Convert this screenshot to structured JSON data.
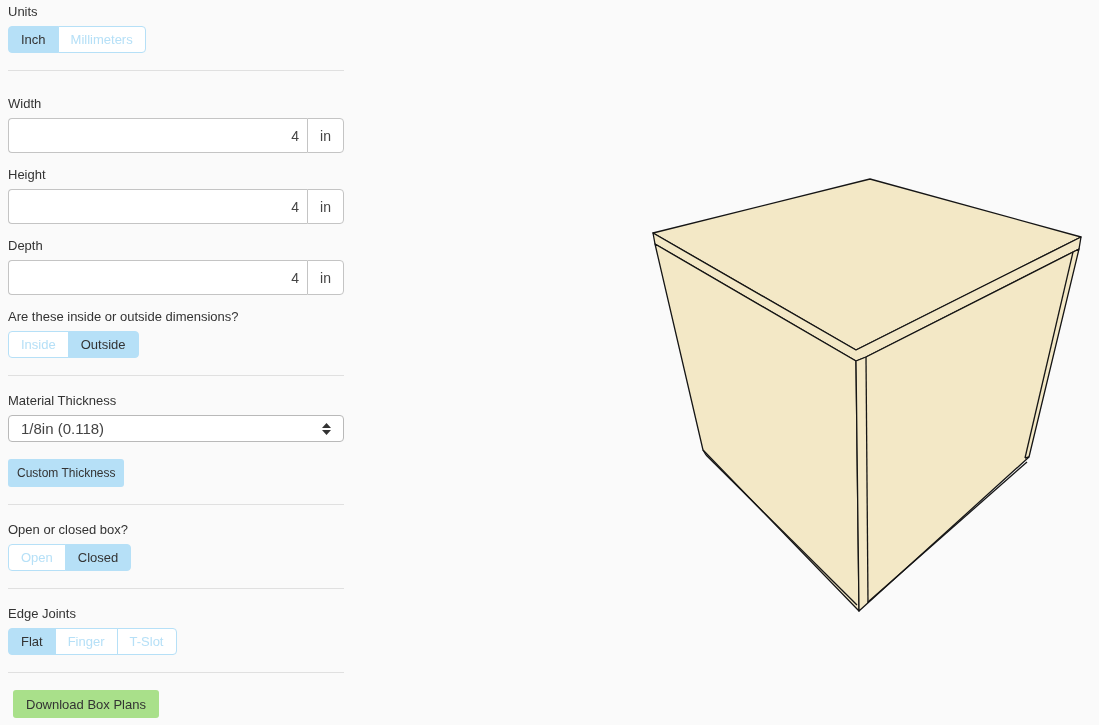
{
  "sections": [
    {
      "items": [
        {
          "kind": "toggle",
          "label": "Units",
          "options": [
            {
              "label": "Inch",
              "selected": true
            },
            {
              "label": "Millimeters",
              "selected": false
            }
          ]
        }
      ]
    },
    {
      "items": [
        {
          "kind": "number_field",
          "label": "Width",
          "value": "4",
          "unit": "in"
        },
        {
          "kind": "number_field",
          "label": "Height",
          "value": "4",
          "unit": "in"
        },
        {
          "kind": "number_field",
          "label": "Depth",
          "value": "4",
          "unit": "in"
        },
        {
          "kind": "toggle",
          "label": "Are these inside or outside dimensions?",
          "options": [
            {
              "label": "Inside",
              "selected": false
            },
            {
              "label": "Outside",
              "selected": true
            }
          ]
        }
      ]
    },
    {
      "items": [
        {
          "kind": "select",
          "label": "Material Thickness",
          "value": "1/8in (0.118)"
        },
        {
          "kind": "button",
          "label": "Custom Thickness"
        }
      ]
    },
    {
      "items": [
        {
          "kind": "toggle",
          "label": "Open or closed box?",
          "options": [
            {
              "label": "Open",
              "selected": false
            },
            {
              "label": "Closed",
              "selected": true
            }
          ]
        }
      ]
    },
    {
      "items": [
        {
          "kind": "toggle",
          "label": "Edge Joints",
          "options": [
            {
              "label": "Flat",
              "selected": true
            },
            {
              "label": "Finger",
              "selected": false
            },
            {
              "label": "T-Slot",
              "selected": false
            }
          ]
        }
      ]
    },
    {
      "items": [
        {
          "kind": "download_button",
          "label": "Download Box Plans"
        }
      ]
    }
  ]
}
